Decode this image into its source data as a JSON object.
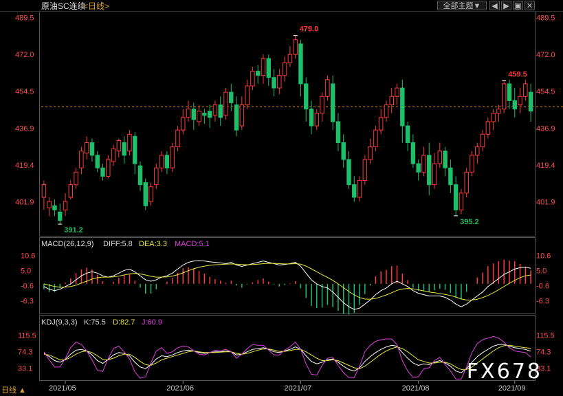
{
  "header": {
    "title": "原油SC连续",
    "period": "<日线>",
    "menu_label": "全部主题▼",
    "icons": [
      "prev-icon",
      "next-icon",
      "image-icon",
      "close-icon"
    ]
  },
  "colors": {
    "up": "#ff3b3b",
    "down": "#1fbf6a",
    "axis": "#ff4d4d",
    "orange_line": "#e08a1e",
    "white_line": "#ffffff",
    "yellow_line": "#e6e63c",
    "magenta_line": "#e040e0",
    "grid": "#2a2a2a"
  },
  "panels": {
    "macd": {
      "label": "MACD(26,12,9)",
      "diff": "DIFF:5.8",
      "dea": "DEA:3.3",
      "macd": "MACD:5.1"
    },
    "kdj": {
      "label": "KDJ(9,3,3)",
      "k": "K:75.5",
      "d": "D:82.7",
      "j": "J:60.9"
    }
  },
  "footer": {
    "period_label": "日线 ▲",
    "watermark": "FX678"
  },
  "chart_data": [
    {
      "type": "candlestick",
      "title": "原油SC连续",
      "yticks": [
        "489.5",
        "472.0",
        "454.5",
        "436.9",
        "419.4",
        "401.9"
      ],
      "ylim": [
        386,
        492
      ],
      "current_price": 447.1,
      "xticks": [
        "2021/05",
        "2021/06",
        "2021/07",
        "2021/08",
        "2021/09"
      ],
      "annotations": [
        {
          "text": "479.0"
        },
        {
          "text": "459.5"
        },
        {
          "text": "391.2"
        },
        {
          "text": "395.2"
        }
      ],
      "candles": [
        [
          404,
          410,
          398,
          412
        ],
        [
          399,
          402,
          395,
          404
        ],
        [
          400,
          398,
          395,
          403
        ],
        [
          397,
          393,
          391.2,
          401
        ],
        [
          398,
          402,
          395,
          406
        ],
        [
          404,
          410,
          403,
          412
        ],
        [
          410,
          416,
          408,
          418
        ],
        [
          418,
          426,
          415,
          428
        ],
        [
          425,
          430,
          422,
          433
        ],
        [
          430,
          424,
          421,
          432
        ],
        [
          424,
          418,
          416,
          426
        ],
        [
          418,
          414,
          412,
          420
        ],
        [
          414,
          422,
          413,
          424
        ],
        [
          421,
          427,
          419,
          429
        ],
        [
          426,
          431,
          423,
          432
        ],
        [
          430,
          424,
          420,
          433
        ],
        [
          426,
          434,
          424,
          436
        ],
        [
          433,
          420,
          415,
          435
        ],
        [
          419,
          410,
          407,
          421
        ],
        [
          411,
          400,
          398,
          413
        ],
        [
          402,
          409,
          400,
          411
        ],
        [
          410,
          418,
          408,
          420
        ],
        [
          418,
          424,
          416,
          426
        ],
        [
          424,
          418,
          415,
          426
        ],
        [
          418,
          428,
          416,
          430
        ],
        [
          428,
          436,
          426,
          438
        ],
        [
          436,
          442,
          434,
          446
        ],
        [
          442,
          446,
          440,
          450
        ],
        [
          446,
          441,
          436,
          449
        ],
        [
          440,
          445,
          438,
          448
        ],
        [
          444,
          443,
          439,
          446
        ],
        [
          445,
          442,
          437,
          448
        ],
        [
          443,
          448,
          440,
          450
        ],
        [
          448,
          442,
          438,
          452
        ],
        [
          443,
          454,
          441,
          456
        ],
        [
          454,
          449,
          445,
          458
        ],
        [
          448,
          436,
          433,
          452
        ],
        [
          438,
          448,
          436,
          452
        ],
        [
          448,
          457,
          446,
          460
        ],
        [
          457,
          464,
          455,
          466
        ],
        [
          464,
          462,
          458,
          467
        ],
        [
          462,
          470,
          458,
          472
        ],
        [
          470,
          461,
          457,
          472
        ],
        [
          461,
          456,
          452,
          465
        ],
        [
          456,
          462,
          453,
          465
        ],
        [
          462,
          468,
          459,
          471
        ],
        [
          468,
          472,
          466,
          476
        ],
        [
          472,
          479,
          470,
          481
        ],
        [
          477,
          458,
          452,
          479
        ],
        [
          458,
          446,
          440,
          461
        ],
        [
          446,
          438,
          434,
          450
        ],
        [
          438,
          444,
          436,
          446
        ],
        [
          444,
          452,
          440,
          454
        ],
        [
          452,
          460,
          450,
          462
        ],
        [
          458,
          440,
          436,
          462
        ],
        [
          440,
          430,
          426,
          444
        ],
        [
          430,
          422,
          418,
          434
        ],
        [
          422,
          410,
          408,
          426
        ],
        [
          410,
          404,
          402,
          414
        ],
        [
          404,
          412,
          402,
          414
        ],
        [
          412,
          422,
          410,
          424
        ],
        [
          422,
          428,
          420,
          432
        ],
        [
          428,
          436,
          426,
          438
        ],
        [
          436,
          442,
          434,
          446
        ],
        [
          442,
          448,
          440,
          450
        ],
        [
          448,
          452,
          444,
          456
        ],
        [
          452,
          456,
          448,
          458
        ],
        [
          456,
          438,
          430,
          460
        ],
        [
          438,
          430,
          426,
          440
        ],
        [
          430,
          420,
          418,
          434
        ],
        [
          420,
          416,
          412,
          422
        ],
        [
          416,
          424,
          414,
          428
        ],
        [
          424,
          410,
          405,
          430
        ],
        [
          410,
          420,
          408,
          425
        ],
        [
          420,
          426,
          418,
          430
        ],
        [
          426,
          418,
          414,
          428
        ],
        [
          418,
          410,
          406,
          422
        ],
        [
          410,
          398,
          395.2,
          414
        ],
        [
          398,
          406,
          396,
          408
        ],
        [
          406,
          416,
          404,
          418
        ],
        [
          416,
          424,
          414,
          426
        ],
        [
          424,
          428,
          420,
          430
        ],
        [
          428,
          434,
          426,
          436
        ],
        [
          434,
          440,
          432,
          442
        ],
        [
          440,
          444,
          436,
          446
        ],
        [
          444,
          446,
          440,
          448
        ],
        [
          446,
          458,
          444,
          459.5
        ],
        [
          458,
          450,
          446,
          460
        ],
        [
          450,
          446,
          442,
          456
        ],
        [
          448,
          452,
          444,
          456
        ],
        [
          452,
          458,
          450,
          460
        ],
        [
          454,
          445,
          440,
          458
        ]
      ]
    },
    {
      "type": "bar",
      "title": "MACD(26,12,9)",
      "yticks": [
        "10.6",
        "5.0",
        "-0.6",
        "-6.3"
      ],
      "ylim": [
        -11,
        13
      ],
      "series": [
        {
          "name": "DIFF",
          "values": [
            -1,
            -2,
            -2.5,
            -2,
            -1,
            0,
            1.5,
            3,
            4,
            4.5,
            4,
            3,
            2.5,
            3,
            4,
            5,
            5.5,
            4.5,
            3,
            1.5,
            1,
            1.5,
            2.5,
            3,
            4,
            5.5,
            7,
            8,
            8.5,
            8.6,
            8.5,
            8.2,
            8,
            7.8,
            7.5,
            8,
            7,
            6.5,
            7,
            7.5,
            8,
            8.5,
            8,
            7.5,
            7,
            7.2,
            7.5,
            8,
            6.5,
            4,
            1.5,
            0,
            -1,
            -1.5,
            -3,
            -5,
            -7,
            -8.5,
            -9.5,
            -9,
            -7.5,
            -6,
            -4,
            -2.5,
            -1.5,
            0,
            1,
            0,
            -1,
            -2.5,
            -3.5,
            -4,
            -4.5,
            -4.5,
            -4.5,
            -5,
            -6,
            -7.5,
            -8.5,
            -7.5,
            -6,
            -4.5,
            -3,
            -1,
            0.5,
            2,
            3.5,
            4.5,
            5.5,
            6,
            6.2,
            5.8
          ]
        },
        {
          "name": "DEA",
          "values": [
            0,
            -0.5,
            -1,
            -1.2,
            -1.2,
            -1,
            -0.5,
            0.3,
            1,
            1.8,
            2.3,
            2.5,
            2.5,
            2.6,
            2.9,
            3.3,
            3.7,
            3.9,
            3.7,
            3.3,
            2.8,
            2.5,
            2.5,
            2.6,
            2.9,
            3.4,
            4.1,
            4.9,
            5.6,
            6.2,
            6.6,
            6.9,
            7.1,
            7.2,
            7.3,
            7.4,
            7.3,
            7.2,
            7.1,
            7.2,
            7.3,
            7.5,
            7.6,
            7.6,
            7.5,
            7.4,
            7.4,
            7.5,
            7.3,
            6.6,
            5.6,
            4.5,
            3.4,
            2.4,
            1.3,
            0,
            -1.4,
            -2.8,
            -4.1,
            -5.1,
            -5.6,
            -5.7,
            -5.4,
            -4.8,
            -4.1,
            -3.3,
            -2.4,
            -1.9,
            -1.7,
            -1.8,
            -2.2,
            -2.6,
            -3,
            -3.3,
            -3.6,
            -3.9,
            -4.3,
            -4.9,
            -5.6,
            -6,
            -6,
            -5.7,
            -5.1,
            -4.3,
            -3.3,
            -2.2,
            -1,
            0.2,
            1.3,
            2.3,
            3,
            3.3
          ]
        }
      ]
    },
    {
      "type": "line",
      "title": "KDJ(9,3,3)",
      "yticks": [
        "115.5",
        "74.3",
        "33.1"
      ],
      "ylim": [
        5,
        135
      ],
      "series": [
        {
          "name": "K",
          "values": [
            70,
            62,
            52,
            48,
            55,
            68,
            78,
            80,
            76,
            66,
            52,
            45,
            55,
            66,
            72,
            70,
            64,
            48,
            36,
            32,
            42,
            56,
            64,
            62,
            66,
            72,
            76,
            78,
            76,
            72,
            70,
            72,
            74,
            74,
            76,
            74,
            66,
            68,
            74,
            80,
            82,
            84,
            80,
            74,
            72,
            76,
            80,
            86,
            80,
            64,
            50,
            44,
            48,
            54,
            56,
            48,
            38,
            30,
            26,
            34,
            50,
            62,
            72,
            80,
            86,
            90,
            88,
            72,
            58,
            46,
            40,
            44,
            42,
            48,
            52,
            46,
            38,
            26,
            22,
            32,
            48,
            62,
            72,
            80,
            88,
            92,
            92,
            88,
            84,
            82,
            80,
            75.5
          ]
        },
        {
          "name": "D",
          "values": [
            68,
            66,
            60,
            54,
            54,
            60,
            68,
            74,
            76,
            72,
            64,
            55,
            54,
            58,
            64,
            68,
            68,
            60,
            50,
            42,
            40,
            46,
            54,
            58,
            62,
            66,
            70,
            74,
            76,
            74,
            72,
            72,
            72,
            73,
            74,
            74,
            70,
            68,
            70,
            74,
            78,
            81,
            81,
            78,
            75,
            75,
            77,
            80,
            80,
            74,
            66,
            58,
            52,
            52,
            54,
            52,
            46,
            40,
            34,
            32,
            38,
            48,
            58,
            68,
            76,
            82,
            86,
            82,
            74,
            64,
            54,
            50,
            46,
            46,
            48,
            48,
            44,
            36,
            30,
            30,
            36,
            46,
            56,
            66,
            76,
            84,
            89,
            90,
            88,
            86,
            84,
            82.7
          ]
        },
        {
          "name": "J",
          "values": [
            74,
            54,
            36,
            36,
            57,
            84,
            98,
            92,
            76,
            54,
            28,
            25,
            57,
            82,
            88,
            74,
            56,
            24,
            8,
            12,
            46,
            76,
            84,
            70,
            74,
            84,
            88,
            86,
            76,
            68,
            66,
            72,
            78,
            76,
            80,
            74,
            58,
            68,
            82,
            92,
            90,
            90,
            78,
            66,
            66,
            78,
            86,
            98,
            80,
            44,
            18,
            16,
            40,
            58,
            60,
            40,
            22,
            10,
            10,
            38,
            74,
            90,
            100,
            104,
            106,
            106,
            92,
            52,
            26,
            10,
            12,
            32,
            34,
            52,
            60,
            42,
            26,
            6,
            6,
            36,
            72,
            94,
            104,
            108,
            112,
            108,
            98,
            84,
            76,
            74,
            72,
            60.9
          ]
        }
      ]
    }
  ]
}
